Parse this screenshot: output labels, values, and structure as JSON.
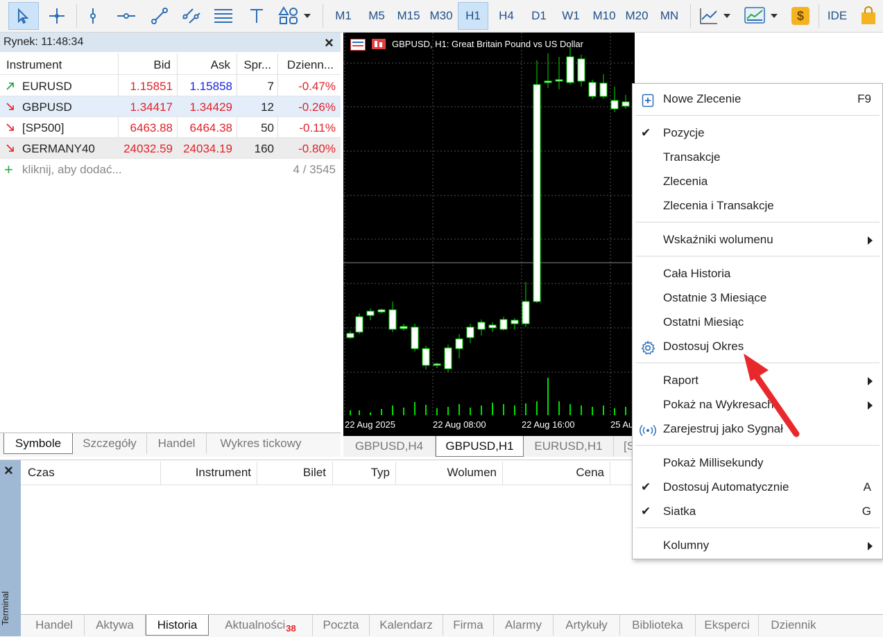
{
  "toolbar": {
    "timeframes": [
      "M1",
      "M5",
      "M15",
      "M30",
      "H1",
      "H4",
      "D1",
      "W1",
      "M10",
      "M20",
      "MN"
    ],
    "active_timeframe": "H1",
    "ide_label": "IDE",
    "dollar_label": "$"
  },
  "market": {
    "title": "Rynek: 11:48:34",
    "columns": [
      "Instrument",
      "Bid",
      "Ask",
      "Spr...",
      "Dzienn..."
    ],
    "rows": [
      {
        "instrument": "EURUSD",
        "bid": "1.15851",
        "ask": "1.15858",
        "spread": "7",
        "daily": "-0.47%",
        "dir": "up"
      },
      {
        "instrument": "GBPUSD",
        "bid": "1.34417",
        "ask": "1.34429",
        "spread": "12",
        "daily": "-0.26%",
        "dir": "down"
      },
      {
        "instrument": "[SP500]",
        "bid": "6463.88",
        "ask": "6464.38",
        "spread": "50",
        "daily": "-0.11%",
        "dir": "down"
      },
      {
        "instrument": "GERMANY40",
        "bid": "24032.59",
        "ask": "24034.19",
        "spread": "160",
        "daily": "-0.80%",
        "dir": "down"
      }
    ],
    "add_placeholder": "kliknij, aby dodać...",
    "count": "4 / 3545",
    "tabs": [
      "Symbole",
      "Szczegóły",
      "Handel",
      "Wykres tickowy"
    ]
  },
  "chart": {
    "title": "GBPUSD, H1:  Great Britain Pound vs US Dollar",
    "time_labels": [
      "22 Aug 2025",
      "22 Aug 08:00",
      "22 Aug 16:00",
      "25 Au"
    ],
    "tabs": [
      "GBPUSD,H4",
      "GBPUSD,H1",
      "EURUSD,H1",
      "[S"
    ],
    "colors": {
      "background": "#000000",
      "candle": "#00e000",
      "grid": "#555555"
    }
  },
  "terminal": {
    "side_label": "Terminal",
    "columns": [
      "Czas",
      "Instrument",
      "Bilet",
      "Typ",
      "Wolumen",
      "Cena"
    ],
    "tabs": [
      "Handel",
      "Aktywa",
      "Historia",
      "Aktualności",
      "Poczta",
      "Kalendarz",
      "Firma",
      "Alarmy",
      "Artykuły",
      "Biblioteka",
      "Eksperci",
      "Dziennik"
    ],
    "news_badge": "38",
    "selected_tab": "Historia"
  },
  "context_menu": {
    "new_order": {
      "label": "Nowe Zlecenie",
      "shortcut": "F9"
    },
    "positions": "Pozycje",
    "transactions": "Transakcje",
    "orders": "Zlecenia",
    "orders_transactions": "Zlecenia i Transakcje",
    "volume_indicators": "Wskaźniki wolumenu",
    "all_history": "Cała Historia",
    "last_3_months": "Ostatnie 3 Miesiące",
    "last_month": "Ostatni Miesiąc",
    "custom_period": "Dostosuj Okres",
    "report": "Raport",
    "show_on_charts": "Pokaż na Wykresach",
    "register_signal": "Zarejestruj jako Sygnał",
    "show_ms": "Pokaż Millisekundy",
    "auto_adjust": {
      "label": "Dostosuj Automatycznie",
      "shortcut": "A"
    },
    "grid": {
      "label": "Siatka",
      "shortcut": "G"
    },
    "columns": "Kolumny"
  }
}
